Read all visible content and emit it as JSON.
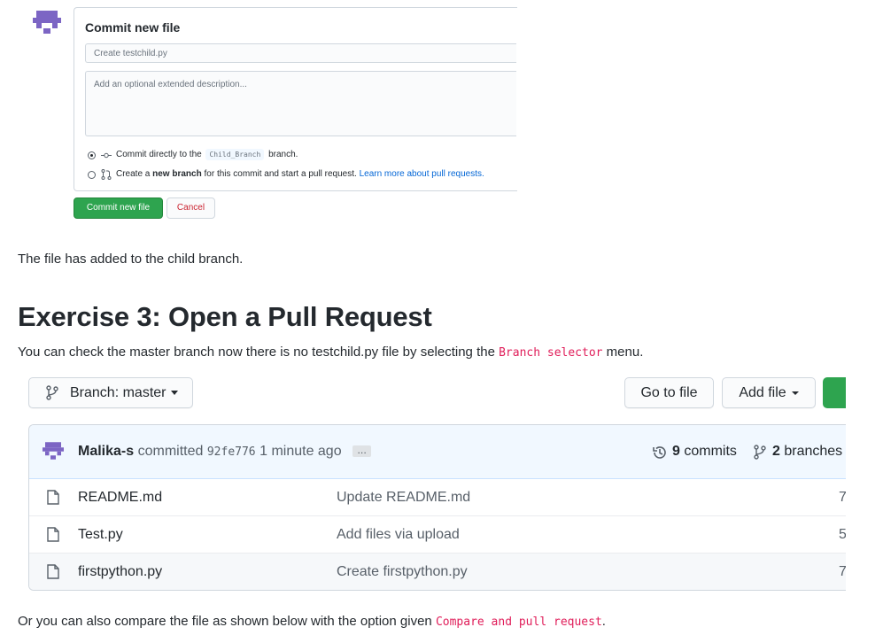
{
  "commit_form": {
    "title": "Commit new file",
    "summary_placeholder": "Create testchild.py",
    "description_placeholder": "Add an optional extended description...",
    "option_direct_prefix": "Commit directly to the",
    "option_direct_branch": "Child_Branch",
    "option_direct_suffix": "branch.",
    "option_new_prefix": "Create a",
    "option_new_bold": "new branch",
    "option_new_suffix": "for this commit and start a pull request.",
    "option_new_link": "Learn more about pull requests.",
    "commit_button": "Commit new file",
    "cancel_button": "Cancel"
  },
  "article": {
    "para1": "The file has added to the child branch.",
    "heading": "Exercise 3: Open a Pull Request",
    "para2_prefix": "You can check the master branch now there is no testchild.py file by selecting the",
    "para2_code": "Branch selector",
    "para2_suffix": "menu.",
    "para3_prefix": "Or you can also compare the file as shown below with the option given",
    "para3_code": "Compare and pull request",
    "para3_suffix": "."
  },
  "repo": {
    "branch_label": "Branch: master",
    "goto_file": "Go to file",
    "add_file": "Add file",
    "commit_author": "Malika-s",
    "commit_verb": "committed",
    "commit_sha": "92fe776",
    "commit_time": "1 minute ago",
    "ellipsis": "…",
    "commits_count": "9",
    "commits_label": "commits",
    "branches_count": "2",
    "branches_label": "branches",
    "files": [
      {
        "name": "README.md",
        "message": "Update README.md",
        "time": "7"
      },
      {
        "name": "Test.py",
        "message": "Add files via upload",
        "time": "5"
      },
      {
        "name": "firstpython.py",
        "message": "Create firstpython.py",
        "time": "7"
      }
    ]
  },
  "colors": {
    "accent_green": "#2ea44f",
    "link_blue": "#0366d6",
    "code_pink": "#e01e5a",
    "cancel_red": "#cb2431"
  }
}
